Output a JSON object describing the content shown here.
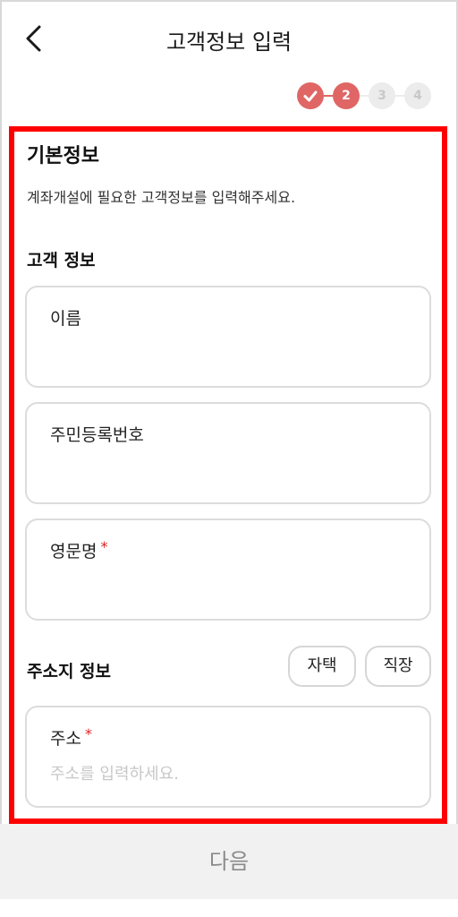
{
  "header": {
    "title": "고객정보 입력",
    "back_icon": "chevron-left-icon"
  },
  "steps": {
    "items": [
      {
        "label": "",
        "status": "done",
        "icon": "check-icon"
      },
      {
        "label": "2",
        "status": "active"
      },
      {
        "label": "3",
        "status": "pending"
      },
      {
        "label": "4",
        "status": "pending"
      }
    ],
    "colors": {
      "active": "#e06666",
      "pending": "#ececec"
    }
  },
  "basic": {
    "title": "기본정보",
    "description": "계좌개설에 필요한 고객정보를 입력해주세요."
  },
  "customer": {
    "title": "고객 정보",
    "fields": [
      {
        "label": "이름",
        "required": false,
        "value": "",
        "placeholder": ""
      },
      {
        "label": "주민등록번호",
        "required": false,
        "value": "",
        "placeholder": ""
      },
      {
        "label": "영문명",
        "required": true,
        "value": "",
        "placeholder": ""
      }
    ]
  },
  "address": {
    "title": "주소지 정보",
    "chips": [
      "자택",
      "직장"
    ],
    "field": {
      "label": "주소",
      "required": true,
      "value": "",
      "placeholder": "주소를 입력하세요."
    }
  },
  "required_mark": "*",
  "footer": {
    "next_label": "다음"
  },
  "accent_color": "#e06666",
  "highlight_color": "#ff0000"
}
